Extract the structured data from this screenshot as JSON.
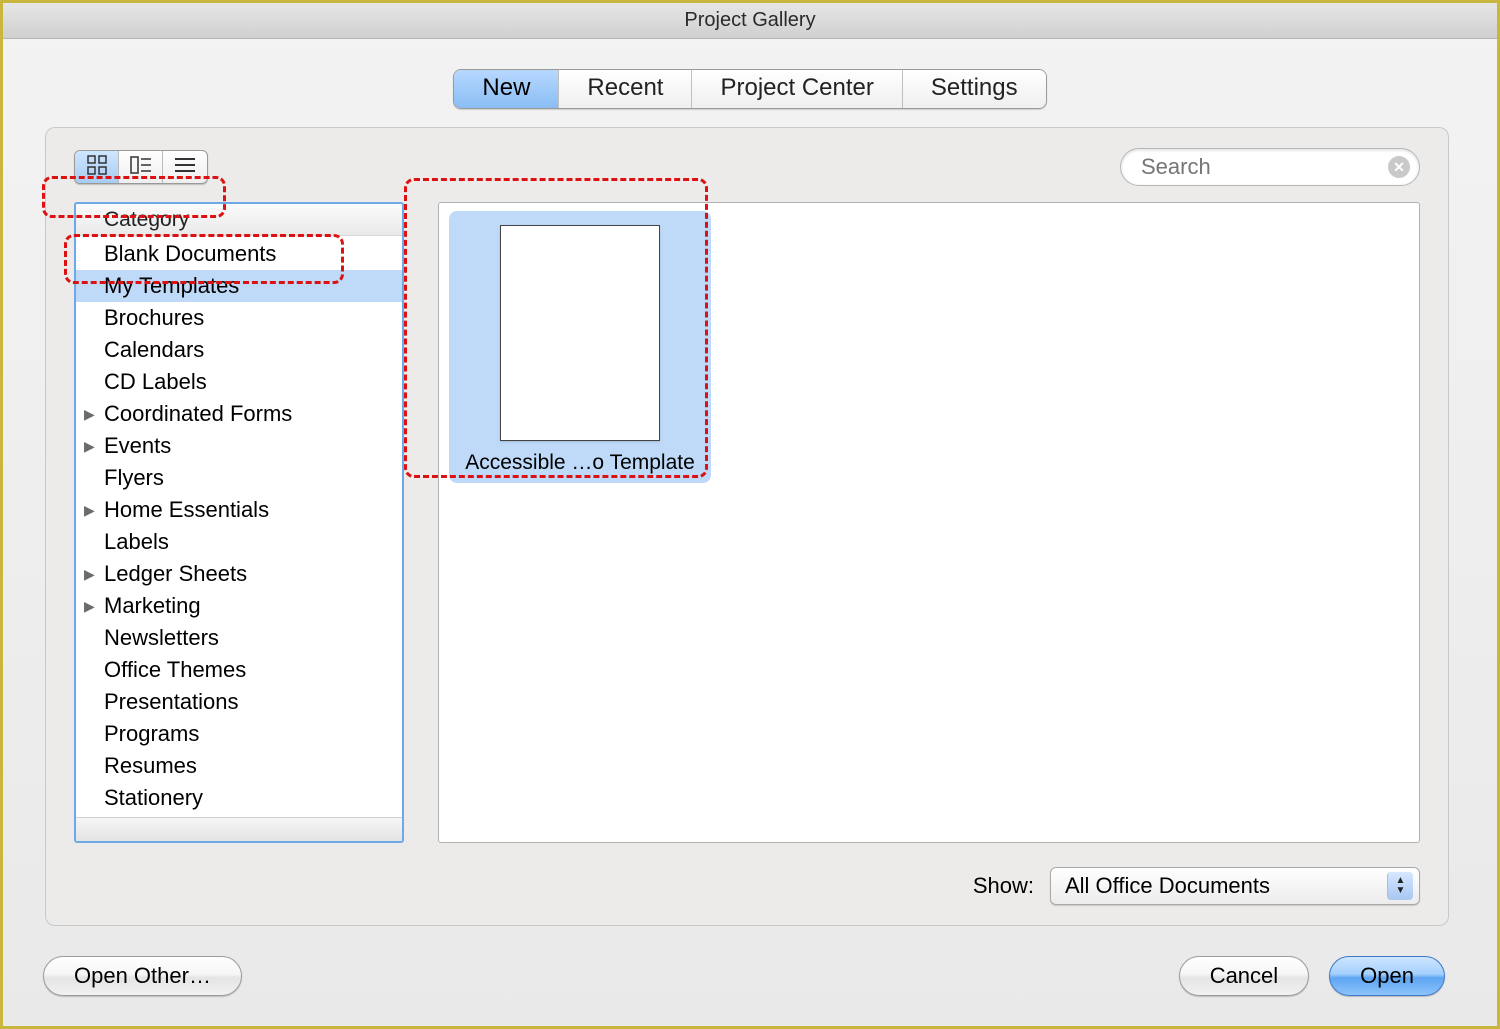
{
  "window": {
    "title": "Project Gallery"
  },
  "tabs": [
    {
      "label": "New",
      "active": true
    },
    {
      "label": "Recent",
      "active": false
    },
    {
      "label": "Project Center",
      "active": false
    },
    {
      "label": "Settings",
      "active": false
    }
  ],
  "search": {
    "placeholder": "Search"
  },
  "sidebar": {
    "header": "Category",
    "items": [
      {
        "label": "Blank Documents",
        "expandable": false,
        "selected": false
      },
      {
        "label": "My Templates",
        "expandable": false,
        "selected": true
      },
      {
        "label": "Brochures",
        "expandable": false,
        "selected": false
      },
      {
        "label": "Calendars",
        "expandable": false,
        "selected": false
      },
      {
        "label": "CD Labels",
        "expandable": false,
        "selected": false
      },
      {
        "label": "Coordinated Forms",
        "expandable": true,
        "selected": false
      },
      {
        "label": "Events",
        "expandable": true,
        "selected": false
      },
      {
        "label": "Flyers",
        "expandable": false,
        "selected": false
      },
      {
        "label": "Home Essentials",
        "expandable": true,
        "selected": false
      },
      {
        "label": "Labels",
        "expandable": false,
        "selected": false
      },
      {
        "label": "Ledger Sheets",
        "expandable": true,
        "selected": false
      },
      {
        "label": "Marketing",
        "expandable": true,
        "selected": false
      },
      {
        "label": "Newsletters",
        "expandable": false,
        "selected": false
      },
      {
        "label": "Office Themes",
        "expandable": false,
        "selected": false
      },
      {
        "label": "Presentations",
        "expandable": false,
        "selected": false
      },
      {
        "label": "Programs",
        "expandable": false,
        "selected": false
      },
      {
        "label": "Resumes",
        "expandable": false,
        "selected": false
      },
      {
        "label": "Stationery",
        "expandable": false,
        "selected": false
      }
    ]
  },
  "templates": [
    {
      "label": "Accessible …o Template",
      "selected": true
    }
  ],
  "show": {
    "label": "Show:",
    "value": "All Office Documents"
  },
  "buttons": {
    "open_other": "Open Other…",
    "cancel": "Cancel",
    "open": "Open"
  }
}
